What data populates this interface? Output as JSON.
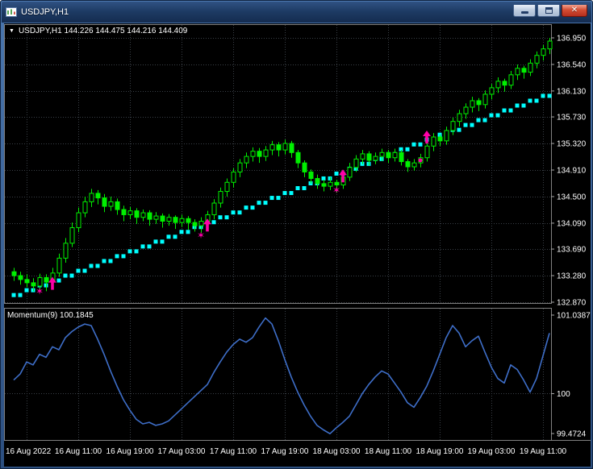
{
  "window": {
    "title": "USDJPY,H1",
    "minimize_label": "Minimize",
    "restore_label": "Restore",
    "close_label": "Close",
    "close_glyph": "✕"
  },
  "chart": {
    "dropdown_glyph": "▼",
    "legend": "USDJPY,H1 144.226 144.475 144.216 144.409",
    "momentum_legend": "Momentum(9) 100.1845"
  },
  "colors": {
    "background": "#000000",
    "bull": "#00F000",
    "trail": "#00FFFF",
    "signal": "#FF00A8",
    "momentum_line": "#3E6EC8",
    "grid": "#3A4047",
    "panel_border": "#808080",
    "tick_mark": "#A8A8A8",
    "axis_text": "#FFFFFF"
  },
  "chart_data": [
    {
      "type": "candlestick",
      "symbol": "USDJPY",
      "timeframe": "H1",
      "legend": "USDJPY,H1 144.226 144.475 144.216 144.409",
      "price_ticks": [
        "136.950",
        "136.540",
        "136.130",
        "135.730",
        "135.320",
        "134.910",
        "134.500",
        "134.090",
        "133.690",
        "133.280",
        "132.870"
      ],
      "price_range": [
        132.87,
        136.95
      ],
      "time_ticks": [
        {
          "index": 2,
          "label": "16 Aug 2022"
        },
        {
          "index": 10,
          "label": "16 Aug 11:00"
        },
        {
          "index": 18,
          "label": "16 Aug 19:00"
        },
        {
          "index": 26,
          "label": "17 Aug 03:00"
        },
        {
          "index": 34,
          "label": "17 Aug 11:00"
        },
        {
          "index": 42,
          "label": "17 Aug 19:00"
        },
        {
          "index": 50,
          "label": "18 Aug 03:00"
        },
        {
          "index": 58,
          "label": "18 Aug 11:00"
        },
        {
          "index": 66,
          "label": "18 Aug 19:00"
        },
        {
          "index": 74,
          "label": "19 Aug 03:00"
        },
        {
          "index": 82,
          "label": "19 Aug 11:00"
        }
      ],
      "candles": [
        [
          133.34,
          133.4,
          133.2,
          133.28
        ],
        [
          133.28,
          133.34,
          133.14,
          133.22
        ],
        [
          133.22,
          133.3,
          133.1,
          133.17
        ],
        [
          133.17,
          133.24,
          133.04,
          133.12
        ],
        [
          133.12,
          133.31,
          133.06,
          133.25
        ],
        [
          133.25,
          133.3,
          133.04,
          133.18
        ],
        [
          133.18,
          133.4,
          133.1,
          133.32
        ],
        [
          133.32,
          133.62,
          133.26,
          133.55
        ],
        [
          133.55,
          133.86,
          133.48,
          133.78
        ],
        [
          133.78,
          134.1,
          133.72,
          134.02
        ],
        [
          134.02,
          134.33,
          133.95,
          134.25
        ],
        [
          134.25,
          134.5,
          134.18,
          134.42
        ],
        [
          134.42,
          134.62,
          134.34,
          134.55
        ],
        [
          134.55,
          134.6,
          134.38,
          134.48
        ],
        [
          134.48,
          134.54,
          134.26,
          134.35
        ],
        [
          134.35,
          134.5,
          134.28,
          134.42
        ],
        [
          134.42,
          134.47,
          134.22,
          134.3
        ],
        [
          134.3,
          134.36,
          134.12,
          134.22
        ],
        [
          134.22,
          134.34,
          134.15,
          134.28
        ],
        [
          134.28,
          134.32,
          134.08,
          134.18
        ],
        [
          134.18,
          134.3,
          134.12,
          134.25
        ],
        [
          134.25,
          134.29,
          134.05,
          134.15
        ],
        [
          134.15,
          134.26,
          134.08,
          134.2
        ],
        [
          134.2,
          134.24,
          134.02,
          134.12
        ],
        [
          134.12,
          134.23,
          134.05,
          134.18
        ],
        [
          134.18,
          134.21,
          134.0,
          134.1
        ],
        [
          134.1,
          134.22,
          134.03,
          134.16
        ],
        [
          134.16,
          134.2,
          133.99,
          134.1
        ],
        [
          134.1,
          134.15,
          133.96,
          134.05
        ],
        [
          134.05,
          134.18,
          133.94,
          134.12
        ],
        [
          134.12,
          134.28,
          134.04,
          134.22
        ],
        [
          134.22,
          134.46,
          134.15,
          134.4
        ],
        [
          134.4,
          134.64,
          134.33,
          134.58
        ],
        [
          134.58,
          134.78,
          134.5,
          134.72
        ],
        [
          134.72,
          134.94,
          134.64,
          134.88
        ],
        [
          134.88,
          135.08,
          134.8,
          135.02
        ],
        [
          135.02,
          135.18,
          134.94,
          135.12
        ],
        [
          135.12,
          135.26,
          135.04,
          135.2
        ],
        [
          135.2,
          135.25,
          135.02,
          135.12
        ],
        [
          135.12,
          135.28,
          135.05,
          135.22
        ],
        [
          135.22,
          135.36,
          135.14,
          135.3
        ],
        [
          135.3,
          135.34,
          135.12,
          135.22
        ],
        [
          135.22,
          135.38,
          135.15,
          135.32
        ],
        [
          135.32,
          135.36,
          135.1,
          135.18
        ],
        [
          135.18,
          135.22,
          134.94,
          135.02
        ],
        [
          135.02,
          135.06,
          134.8,
          134.88
        ],
        [
          134.88,
          134.92,
          134.7,
          134.78
        ],
        [
          134.78,
          134.84,
          134.62,
          134.7
        ],
        [
          134.7,
          134.76,
          134.58,
          134.66
        ],
        [
          134.66,
          134.8,
          134.6,
          134.72
        ],
        [
          134.72,
          134.76,
          134.56,
          134.68
        ],
        [
          134.68,
          134.88,
          134.62,
          134.8
        ],
        [
          134.8,
          135.02,
          134.74,
          134.95
        ],
        [
          134.95,
          135.14,
          134.88,
          135.08
        ],
        [
          135.08,
          135.22,
          135.0,
          135.16
        ],
        [
          135.16,
          135.2,
          134.98,
          135.06
        ],
        [
          135.06,
          135.18,
          135.0,
          135.12
        ],
        [
          135.12,
          135.24,
          135.05,
          135.18
        ],
        [
          135.18,
          135.22,
          135.02,
          135.1
        ],
        [
          135.1,
          135.24,
          135.04,
          135.18
        ],
        [
          135.18,
          135.22,
          134.98,
          135.04
        ],
        [
          135.04,
          135.08,
          134.88,
          134.96
        ],
        [
          134.96,
          135.08,
          134.9,
          135.02
        ],
        [
          135.02,
          135.16,
          134.95,
          135.1
        ],
        [
          135.1,
          135.34,
          135.04,
          135.28
        ],
        [
          135.28,
          135.48,
          135.2,
          135.42
        ],
        [
          135.42,
          135.46,
          135.28,
          135.36
        ],
        [
          135.36,
          135.58,
          135.3,
          135.52
        ],
        [
          135.52,
          135.72,
          135.45,
          135.66
        ],
        [
          135.66,
          135.84,
          135.58,
          135.78
        ],
        [
          135.78,
          135.94,
          135.7,
          135.88
        ],
        [
          135.88,
          136.04,
          135.8,
          135.98
        ],
        [
          135.98,
          136.02,
          135.82,
          135.92
        ],
        [
          135.92,
          136.14,
          135.86,
          136.08
        ],
        [
          136.08,
          136.24,
          136.0,
          136.18
        ],
        [
          136.18,
          136.34,
          136.1,
          136.28
        ],
        [
          136.28,
          136.32,
          136.12,
          136.22
        ],
        [
          136.22,
          136.44,
          136.16,
          136.38
        ],
        [
          136.38,
          136.54,
          136.3,
          136.48
        ],
        [
          136.48,
          136.52,
          136.32,
          136.42
        ],
        [
          136.42,
          136.62,
          136.36,
          136.56
        ],
        [
          136.56,
          136.74,
          136.48,
          136.68
        ],
        [
          136.68,
          136.84,
          136.6,
          136.78
        ],
        [
          136.78,
          136.95,
          136.7,
          136.9
        ]
      ],
      "trail": [
        132.98,
        132.98,
        133.055,
        133.055,
        133.13,
        133.13,
        133.205,
        133.205,
        133.28,
        133.28,
        133.355,
        133.355,
        133.43,
        133.43,
        133.505,
        133.505,
        133.58,
        133.58,
        133.655,
        133.655,
        133.73,
        133.73,
        133.805,
        133.805,
        133.88,
        133.88,
        133.955,
        133.955,
        134.03,
        134.03,
        134.105,
        134.105,
        134.18,
        134.18,
        134.255,
        134.255,
        134.33,
        134.33,
        134.405,
        134.405,
        134.48,
        134.48,
        134.555,
        134.555,
        134.63,
        134.63,
        134.705,
        134.705,
        134.78,
        134.78,
        134.855,
        134.855,
        134.93,
        134.93,
        135.005,
        135.005,
        135.08,
        135.08,
        135.155,
        135.155,
        135.23,
        135.23,
        135.305,
        135.305,
        135.38,
        135.38,
        135.455,
        135.455,
        135.53,
        135.53,
        135.605,
        135.605,
        135.68,
        135.68,
        135.755,
        135.755,
        135.83,
        135.83,
        135.905,
        135.905,
        135.98,
        135.98,
        136.055,
        136.055
      ],
      "buy_arrows": [
        {
          "index": 6,
          "price": 133.26
        },
        {
          "index": 30,
          "price": 134.16
        },
        {
          "index": 51,
          "price": 134.92
        },
        {
          "index": 64,
          "price": 135.52
        }
      ],
      "stars": [
        {
          "index": 4,
          "price": 133.04
        },
        {
          "index": 29,
          "price": 133.9
        },
        {
          "index": 50,
          "price": 134.6
        }
      ],
      "dots": [
        {
          "index": 63,
          "price": 135.06
        }
      ]
    },
    {
      "type": "line",
      "name": "Momentum",
      "period": 9,
      "current_value": "100.1845",
      "legend": "Momentum(9) 100.1845",
      "ticks": [
        "101.0387",
        "100",
        "99.4724"
      ],
      "tick_values": [
        101.0387,
        100,
        99.4724
      ],
      "values": [
        100.18,
        100.26,
        100.42,
        100.38,
        100.52,
        100.48,
        100.62,
        100.58,
        100.74,
        100.82,
        100.88,
        100.92,
        100.9,
        100.72,
        100.52,
        100.3,
        100.1,
        99.92,
        99.78,
        99.66,
        99.6,
        99.62,
        99.58,
        99.6,
        99.64,
        99.72,
        99.8,
        99.88,
        99.96,
        100.04,
        100.12,
        100.28,
        100.42,
        100.55,
        100.65,
        100.72,
        100.68,
        100.74,
        100.88,
        101.0,
        100.92,
        100.7,
        100.45,
        100.22,
        100.02,
        99.85,
        99.7,
        99.58,
        99.52,
        99.47,
        99.55,
        99.62,
        99.7,
        99.85,
        100.0,
        100.12,
        100.22,
        100.3,
        100.26,
        100.14,
        100.02,
        99.88,
        99.82,
        99.95,
        100.1,
        100.3,
        100.52,
        100.74,
        100.9,
        100.8,
        100.62,
        100.7,
        100.76,
        100.55,
        100.35,
        100.2,
        100.14,
        100.38,
        100.32,
        100.18,
        100.02,
        100.2,
        100.5,
        100.8
      ]
    }
  ]
}
